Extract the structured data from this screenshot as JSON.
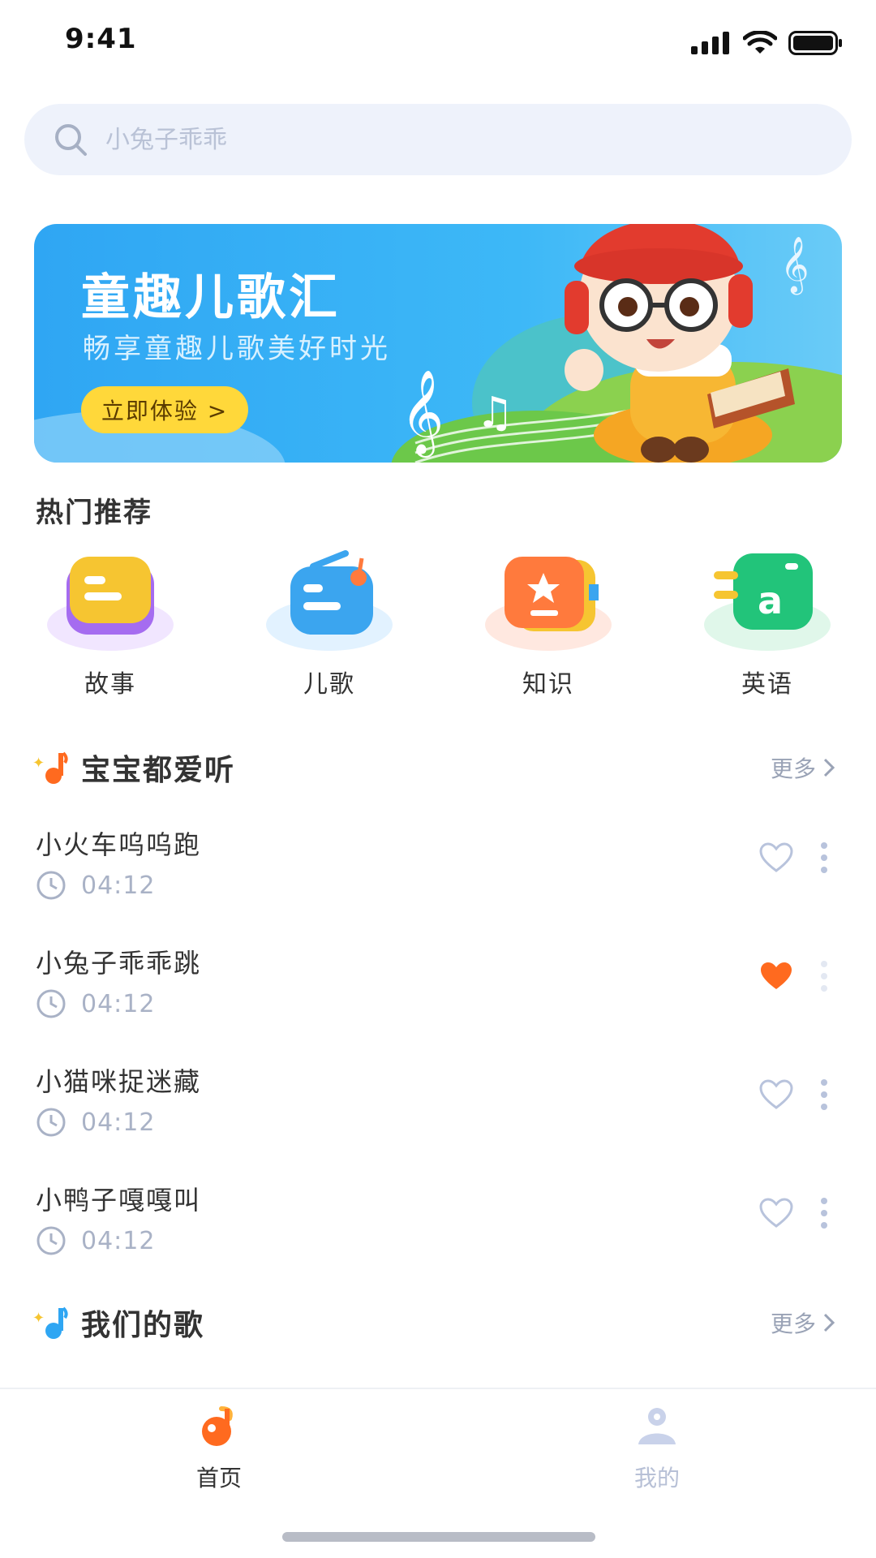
{
  "status_bar": {
    "time": "9:41"
  },
  "search": {
    "placeholder": "小兔子乖乖"
  },
  "banner": {
    "title": "童趣儿歌汇",
    "subtitle": "畅享童趣儿歌美好时光",
    "button_label": "立即体验 >"
  },
  "hot": {
    "title": "热门推荐",
    "categories": [
      {
        "label": "故事",
        "icon": "story-icon",
        "color": "#F6C531"
      },
      {
        "label": "儿歌",
        "icon": "radio-icon",
        "color": "#3BA5EF"
      },
      {
        "label": "知识",
        "icon": "book-icon",
        "color": "#FF7A3D"
      },
      {
        "label": "英语",
        "icon": "english-icon",
        "color": "#22C47A"
      }
    ]
  },
  "sections": [
    {
      "title": "宝宝都爱听",
      "more_label": "更多",
      "songs": [
        {
          "title": "小火车呜呜跑",
          "duration": "04:12",
          "liked": false
        },
        {
          "title": "小兔子乖乖跳",
          "duration": "04:12",
          "liked": true
        },
        {
          "title": "小猫咪捉迷藏",
          "duration": "04:12",
          "liked": false
        },
        {
          "title": "小鸭子嘎嘎叫",
          "duration": "04:12",
          "liked": false
        }
      ]
    },
    {
      "title": "我们的歌",
      "more_label": "更多"
    }
  ],
  "tabbar": {
    "items": [
      {
        "label": "首页",
        "icon": "home-note-icon",
        "active": true
      },
      {
        "label": "我的",
        "icon": "profile-icon",
        "active": false
      }
    ]
  },
  "colors": {
    "accent": "#FF6A1F",
    "banner_blue": "#2FA6F3",
    "button_yellow": "#FFD83A",
    "muted": "#A9B2C6"
  }
}
